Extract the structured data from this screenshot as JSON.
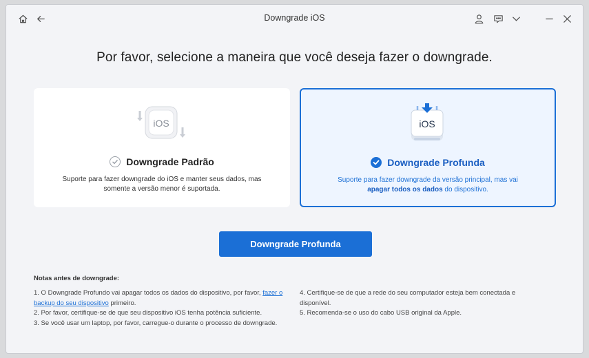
{
  "window": {
    "title": "Downgrade iOS"
  },
  "heading": "Por favor, selecione a maneira que você deseja fazer o downgrade.",
  "cards": [
    {
      "title": "Downgrade Padrão",
      "art_text": "iOS",
      "desc_line1": "Suporte para fazer downgrade do iOS e manter seus dados, mas",
      "desc_line2": "somente a versão menor é suportada.",
      "selected": false
    },
    {
      "title": "Downgrade Profunda",
      "art_text": "iOS",
      "desc_line1": "Suporte para fazer downgrade da versão principal, mas vai",
      "desc_bold": "apagar todos os dados",
      "desc_line2_tail": " do dispositivo.",
      "selected": true
    }
  ],
  "cta_label": "Downgrade Profunda",
  "notes": {
    "title": "Notas antes de downgrade:",
    "n1_pre": "1.  O Downgrade Profundo vai apagar todos os dados do dispositivo, por favor, ",
    "n1_link": "fazer o backup do seu dispositivo",
    "n1_post": " primeiro.",
    "n2": "2.  Por favor, certifique-se de que seu dispositivo iOS tenha potência suficiente.",
    "n3": "3.  Se você usar um laptop, por favor, carregue-o durante o processo de downgrade.",
    "n4": "4.  Certifique-se de que a rede do seu computador esteja bem conectada e disponível.",
    "n5": "5.  Recomenda-se o uso do cabo USB original da Apple."
  },
  "icons": {
    "home": "home-icon",
    "back": "back-arrow-icon",
    "account": "user-icon",
    "feedback": "feedback-icon",
    "menu": "chevron-down-icon",
    "minimize": "minimize-icon",
    "close": "close-icon"
  },
  "colors": {
    "accent": "#1b6fd6",
    "background": "#f3f4f7",
    "selected_card": "#eef5ff"
  }
}
